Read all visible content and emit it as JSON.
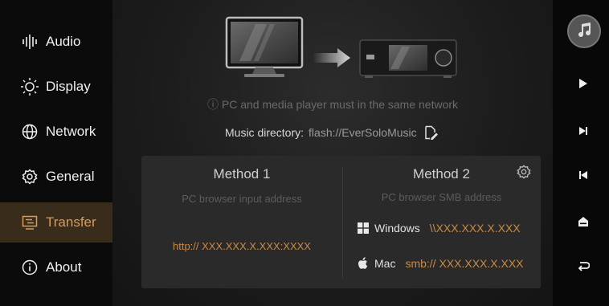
{
  "sidebar": {
    "items": [
      {
        "label": "Audio",
        "icon": "audio-bars-icon"
      },
      {
        "label": "Display",
        "icon": "sun-icon"
      },
      {
        "label": "Network",
        "icon": "globe-icon"
      },
      {
        "label": "General",
        "icon": "gear-icon"
      },
      {
        "label": "Transfer",
        "icon": "transfer-icon",
        "active": true
      },
      {
        "label": "About",
        "icon": "info-icon"
      }
    ]
  },
  "transfer": {
    "note": "ⓘ  PC and media player must in the same network",
    "music_directory_label": "Music directory:",
    "music_directory_value": "flash://EverSoloMusic",
    "method1": {
      "title": "Method 1",
      "subtitle": "PC browser input address",
      "address": "http:// XXX.XXX.X.XXX:XXXX"
    },
    "method2": {
      "title": "Method 2",
      "subtitle": "PC browser SMB address",
      "windows_label": "Windows",
      "windows_address": "\\\\XXX.XXX.X.XXX",
      "mac_label": "Mac",
      "mac_address": "smb:// XXX.XXX.X.XXX"
    }
  },
  "colors": {
    "accent": "#c98a45",
    "active_bg": "#3a2c1a",
    "panel_bg": "#2a2a2a"
  }
}
